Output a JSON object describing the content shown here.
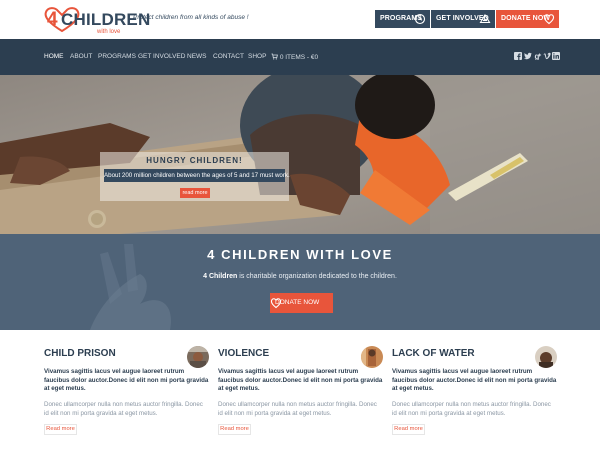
{
  "brand": {
    "logo_num": "4",
    "logo_word": "CHILDREN",
    "logo_sub": "with love",
    "tagline": "Protect children from all kinds of abuse !"
  },
  "top_buttons": {
    "programs": "PROGRAMS",
    "involved": "GET INVOLVED",
    "donate": "DONATE NOW"
  },
  "nav": {
    "items": [
      "HOME",
      "ABOUT",
      "PROGRAMS",
      "GET INVOLVED",
      "NEWS",
      "CONTACT",
      "SHOP"
    ],
    "cart": "0 ITEMS - €0",
    "social_icons": [
      "facebook-icon",
      "twitter-icon",
      "google-plus-icon",
      "vimeo-icon",
      "linkedin-icon"
    ]
  },
  "hero": {
    "title": "HUNGRY CHILDREN!",
    "text": "About 200 million children between the ages of 5 and 17 must work.",
    "button": "read more"
  },
  "band": {
    "title": "4 CHILDREN WITH LOVE",
    "sub_bold": "4 Children",
    "sub_rest": " is charitable organization dedicated to the children.",
    "button": "DONATE NOW"
  },
  "columns": [
    {
      "title": "CHILD PRISON",
      "lead": "Vivamus sagittis lacus vel augue laoreet rutrum faucibus dolor auctor.Donec id elit non mi porta gravida at eget metus.",
      "body": "Donec ullamcorper nulla non metus auctor fringilla. Donec id elit non mi porta gravida at eget metus.",
      "button": "Read more"
    },
    {
      "title": "VIOLENCE",
      "lead": "Vivamus sagittis lacus vel augue laoreet rutrum faucibus dolor auctor.Donec id elit non mi porta gravida at eget metus.",
      "body": "Donec ullamcorper nulla non metus auctor fringilla. Donec id elit non mi porta gravida at eget metus.",
      "button": "Read more"
    },
    {
      "title": "LACK OF WATER",
      "lead": "Vivamus sagittis lacus vel augue laoreet rutrum faucibus dolor auctor.Donec id elit non mi porta gravida at eget metus.",
      "body": "Donec ullamcorper nulla non metus auctor fringilla. Donec id elit non mi porta gravida at eget metus.",
      "button": "Read more"
    }
  ],
  "colors": {
    "accent": "#e8553b",
    "navy": "#2c3e50",
    "slate": "#34495e"
  }
}
